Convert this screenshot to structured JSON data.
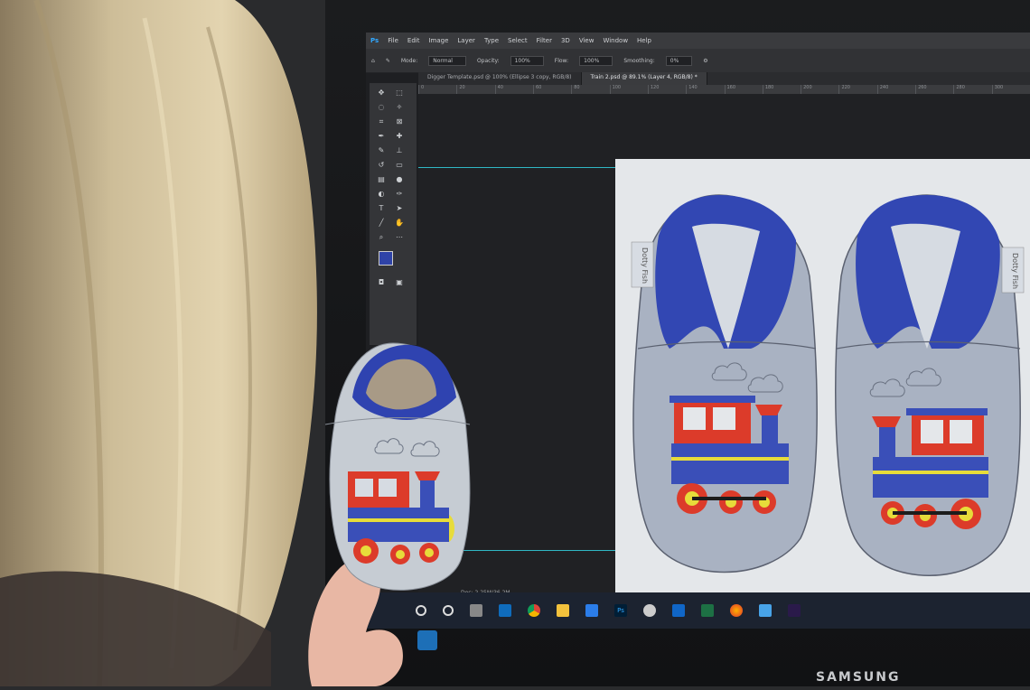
{
  "scene": {
    "description_tag": "photo",
    "monitor_brand": "SAMSUNG"
  },
  "app": {
    "menu": [
      "File",
      "Edit",
      "Image",
      "Layer",
      "Type",
      "Select",
      "Filter",
      "3D",
      "View",
      "Window",
      "Help"
    ],
    "options": {
      "mode_label": "Mode:",
      "mode_value": "Normal",
      "opacity_label": "Opacity:",
      "opacity_value": "100%",
      "flow_label": "Flow:",
      "flow_value": "100%",
      "smoothing_label": "Smoothing:",
      "smoothing_value": "0%"
    },
    "tabs": [
      {
        "label": "Digger Template.psd @ 100% (Ellipse 3 copy, RGB/8)"
      },
      {
        "label": "Train 2.psd @ 89.1% (Layer 4, RGB/8) *"
      }
    ],
    "ruler": [
      "0",
      "20",
      "40",
      "60",
      "80",
      "100",
      "120",
      "140",
      "160",
      "180",
      "200",
      "220",
      "240",
      "260",
      "280",
      "300"
    ],
    "doc_info": "Doc: 2.25M/36.2M"
  },
  "artwork": {
    "tag_text_left": "Dotty Fish",
    "tag_text_right": "Dotty Fish"
  },
  "colors": {
    "shoe_grey": "#a9b2c2",
    "lining_blue": "#3247b3",
    "train_red": "#dc3b2a",
    "train_blue": "#3a4fb8",
    "wheel_yellow": "#e7dc3a",
    "guide_cyan": "#2fb7c4"
  }
}
